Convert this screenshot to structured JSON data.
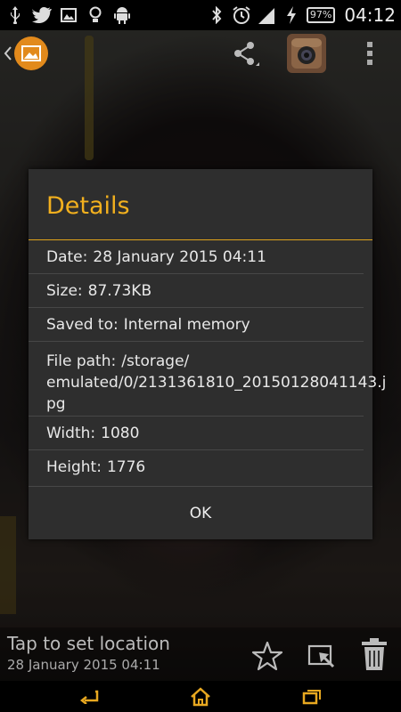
{
  "status_bar": {
    "battery": "97%",
    "time": "04:12"
  },
  "dialog": {
    "title": "Details",
    "rows": [
      {
        "label": "Date:",
        "value": "28 January 2015 04:11"
      },
      {
        "label": "Size:",
        "value": "87.73KB"
      },
      {
        "label": "Saved to:",
        "value": "Internal memory"
      },
      {
        "label": "File path:",
        "value_line1": "/storage/",
        "value_line2": "emulated/0/2131361810_20150128041143.j",
        "value_line3": "pg"
      },
      {
        "label": "Width:",
        "value": "1080"
      },
      {
        "label": "Height:",
        "value": "1776"
      }
    ],
    "ok_label": "OK"
  },
  "info_bar": {
    "location_prompt": "Tap to set location",
    "date": "28 January 2015 04:11"
  },
  "colors": {
    "accent": "#f2b01e",
    "dialog_bg": "#2e2e2e",
    "nav_icon": "#e8a820"
  },
  "icons": [
    "usb-icon",
    "twitter-icon",
    "image-icon",
    "bulb-icon",
    "android-icon",
    "bluetooth-icon",
    "alarm-icon",
    "signal-icon",
    "charging-icon",
    "share-icon",
    "instagram-icon",
    "overflow-icon",
    "star-icon",
    "edit-icon",
    "trash-icon",
    "back-icon",
    "home-icon",
    "recents-icon"
  ]
}
